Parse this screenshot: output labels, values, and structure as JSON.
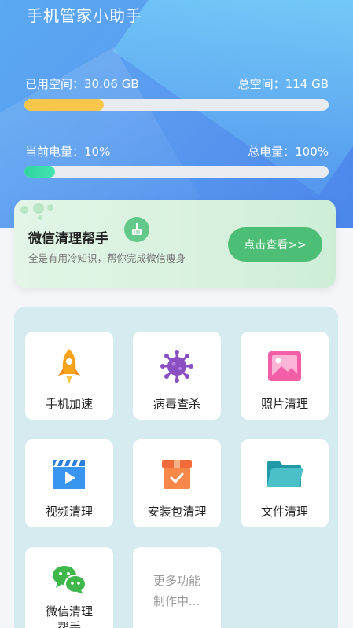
{
  "header": {
    "title": "手机管家小助手",
    "storage": {
      "used_label": "已用空间：30.06 GB",
      "total_label": "总空间：114 GB",
      "fraction": 0.26
    },
    "battery": {
      "current_label": "当前电量：10%",
      "total_label": "总电量：100%",
      "fraction": 0.1
    }
  },
  "promo": {
    "title": "微信清理帮手",
    "subtitle": "全是有用冷知识，帮你完成微信瘦身",
    "button_label": "点击查看>>"
  },
  "tools": [
    {
      "label": "手机加速",
      "icon": "rocket-icon"
    },
    {
      "label": "病毒查杀",
      "icon": "virus-icon"
    },
    {
      "label": "照片清理",
      "icon": "photo-icon"
    },
    {
      "label": "视频清理",
      "icon": "video-icon"
    },
    {
      "label": "安装包清理",
      "icon": "package-icon"
    },
    {
      "label": "文件清理",
      "icon": "folder-icon"
    },
    {
      "label": "微信清理\n帮手",
      "icon": "wechat-icon"
    },
    {
      "label": "更多功能\n制作中...",
      "icon": ""
    }
  ],
  "colors": {
    "storage_bar": "#f7c64a",
    "battery_bar": "#2ed4a0",
    "promo_button": "#4dbe75"
  }
}
